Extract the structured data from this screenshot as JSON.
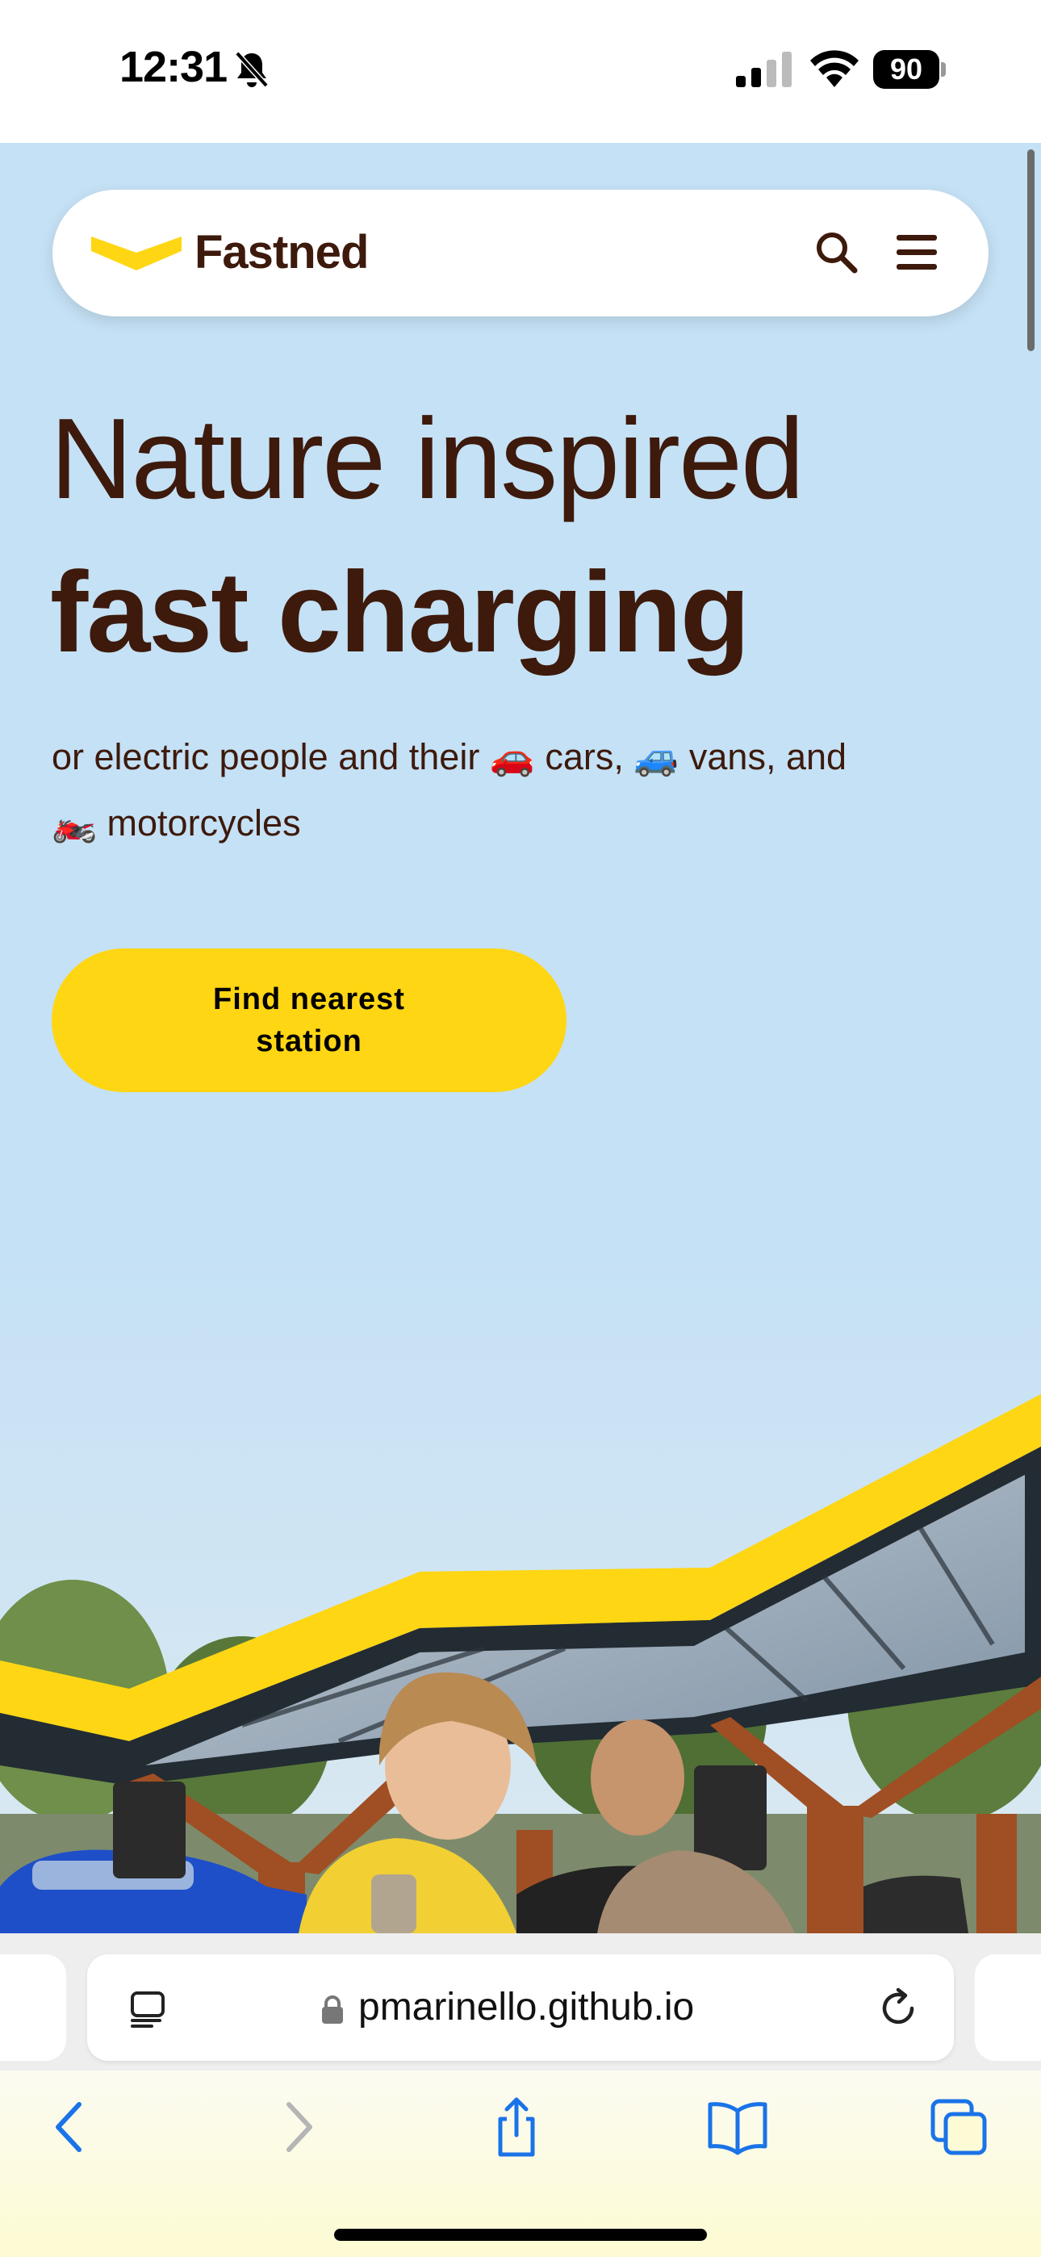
{
  "status_bar": {
    "time": "12:31",
    "battery": "90"
  },
  "browser": {
    "url": "pmarinello.github.io"
  },
  "site": {
    "brand": "Fastned",
    "brand_color": "#ffd614",
    "text_color": "#3d1a0c",
    "background": "#c5e1f5"
  },
  "hero": {
    "title_line1": "Nature inspired",
    "title_line2": "fast charging",
    "subtitle": "or electric people and their 🚗 cars, 🚙 vans, and 🏍️ motorcycles",
    "cta_label": "Find nearest station"
  },
  "icons": {
    "nav": [
      "search-icon",
      "hamburger-menu-icon"
    ],
    "toolbar": [
      "back-icon",
      "forward-icon",
      "share-icon",
      "bookmarks-icon",
      "tabs-icon"
    ]
  }
}
